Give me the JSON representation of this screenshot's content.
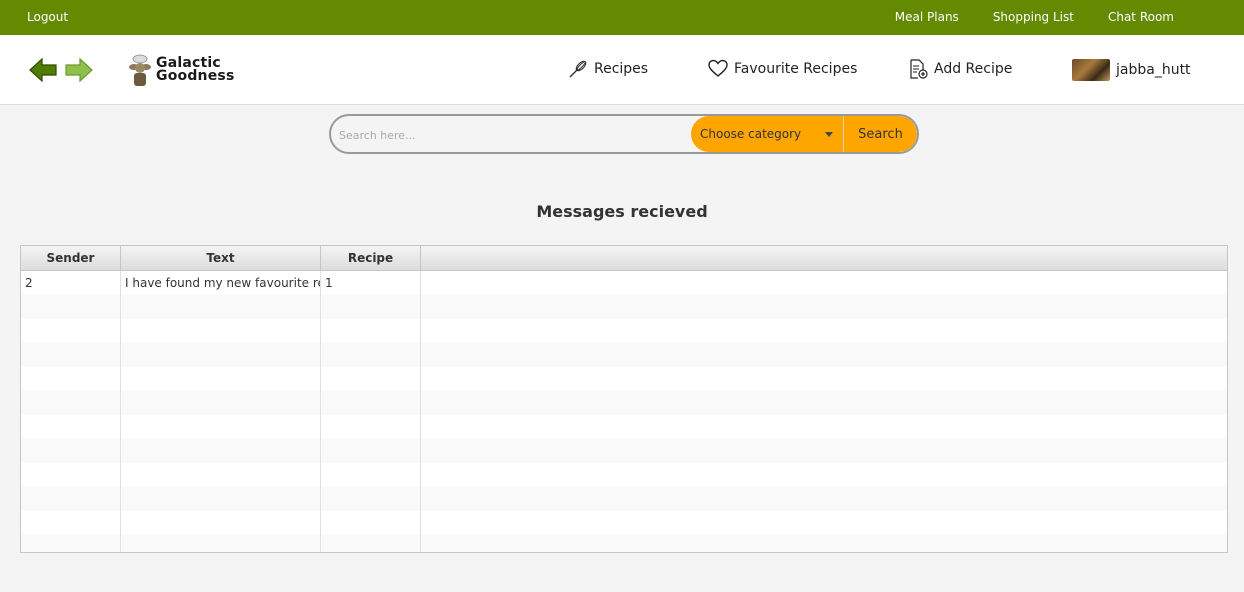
{
  "topbar": {
    "logout_label": "Logout",
    "links": [
      "Meal Plans",
      "Shopping List",
      "Chat Room"
    ]
  },
  "nav": {
    "back_icon": "arrow-left-icon",
    "forward_icon": "arrow-right-icon",
    "brand_line1": "Galactic",
    "brand_line2": "Goodness",
    "recipes_label": "Recipes",
    "favourite_label": "Favourite Recipes",
    "add_recipe_label": "Add Recipe",
    "username": "jabba_hutt"
  },
  "search": {
    "placeholder": "Search here...",
    "category_label": "Choose category",
    "button_label": "Search"
  },
  "page_title": "Messages recieved",
  "table": {
    "columns": [
      "Sender",
      "Text",
      "Recipe",
      ""
    ],
    "rows": [
      [
        "2",
        "I have found my new favourite reci…",
        "1",
        ""
      ]
    ]
  },
  "colors": {
    "topbar": "#638a00",
    "accent": "#ffa500",
    "arrow_back": "#4e7d00",
    "arrow_forward": "#8fc04a"
  }
}
